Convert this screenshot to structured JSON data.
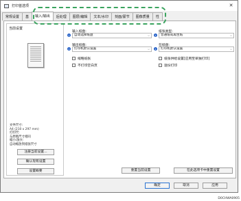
{
  "window": {
    "title": "打印首选项",
    "close_glyph": "✕"
  },
  "tabs": [
    {
      "label": "常规设置"
    },
    {
      "label": "基"
    },
    {
      "label": "输入/输出",
      "active": true
    },
    {
      "label": "后处理"
    },
    {
      "label": "图层/编辑"
    },
    {
      "label": "文本/水印"
    },
    {
      "label": "刻面/蒙节"
    },
    {
      "label": "图像质量"
    },
    {
      "label": "性"
    }
  ],
  "preview": {
    "label": "当前设置",
    "info": [
      "文件尺寸:",
      "A4 (210 x 297 mm)",
      "打印尺:",
      "与原稿尺寸相同",
      "缩小/放大:",
      "自动缩放到纸张尺寸"
    ],
    "buttons": {
      "register": "注册当前设置...",
      "confirm": "确认现有设置",
      "reset": "设置概要"
    }
  },
  "fields": {
    "input_tray": {
      "label": "输入纸盘:",
      "value": "自动选择纸盘"
    },
    "paper_type": {
      "label": "纸张类型:",
      "value": "普通纸或再生纸"
    },
    "output_tray": {
      "label": "输出纸盘:",
      "value": "打印机默认设置"
    },
    "paper_source": {
      "label": "在纸盘:",
      "value": "打印机默认设置"
    }
  },
  "checkboxes": {
    "cover": "缩略纸张",
    "enable_tray": "纸张供给设置[应用至单独打印]",
    "skip_blank": "不打印空白页",
    "staple": "逐份打印"
  },
  "actions": {
    "restore_defaults": "重置当前设置",
    "restore_tab": "在此选项卡中重置设置"
  },
  "footer": {
    "ok": "确定",
    "cancel": "取消",
    "apply": "应用"
  },
  "image_code": "D0CHWA0905"
}
